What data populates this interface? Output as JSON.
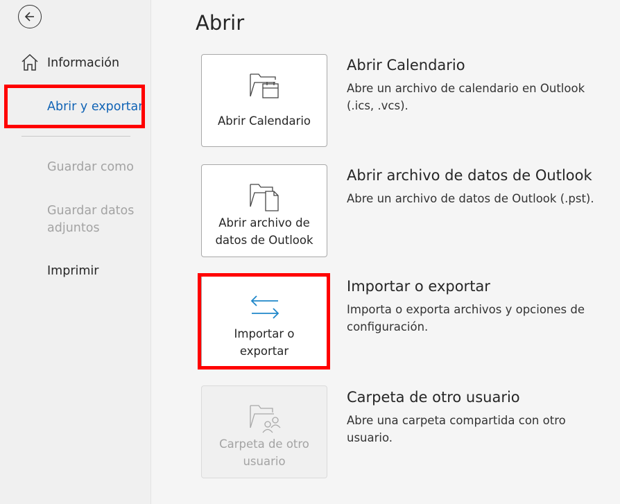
{
  "sidebar": {
    "items": [
      {
        "label": "Información"
      },
      {
        "label": "Abrir y exportar"
      },
      {
        "label": "Guardar como"
      },
      {
        "label": "Guardar datos adjuntos"
      },
      {
        "label": "Imprimir"
      }
    ]
  },
  "main": {
    "title": "Abrir",
    "options": [
      {
        "tile_label": "Abrir Calendario",
        "title": "Abrir Calendario",
        "description": "Abre un archivo de calendario en Outlook (.ics, .vcs).",
        "icon": "folder-calendar-icon"
      },
      {
        "tile_label": "Abrir archivo de datos de Outlook",
        "title": "Abrir archivo de datos de Outlook",
        "description": "Abre un archivo de datos de Outlook (.pst).",
        "icon": "folder-file-icon"
      },
      {
        "tile_label": "Importar o exportar",
        "title": "Importar o exportar",
        "description": "Importa o exporta archivos y opciones de configuración.",
        "icon": "arrows-exchange-icon"
      },
      {
        "tile_label": "Carpeta de otro usuario",
        "title": "Carpeta de otro usuario",
        "description": "Abre una carpeta compartida con otro usuario.",
        "icon": "folder-users-icon"
      }
    ]
  },
  "colors": {
    "accent": "#1063b5",
    "highlight": "#ff0000",
    "arrow_icon": "#1f87c9"
  }
}
